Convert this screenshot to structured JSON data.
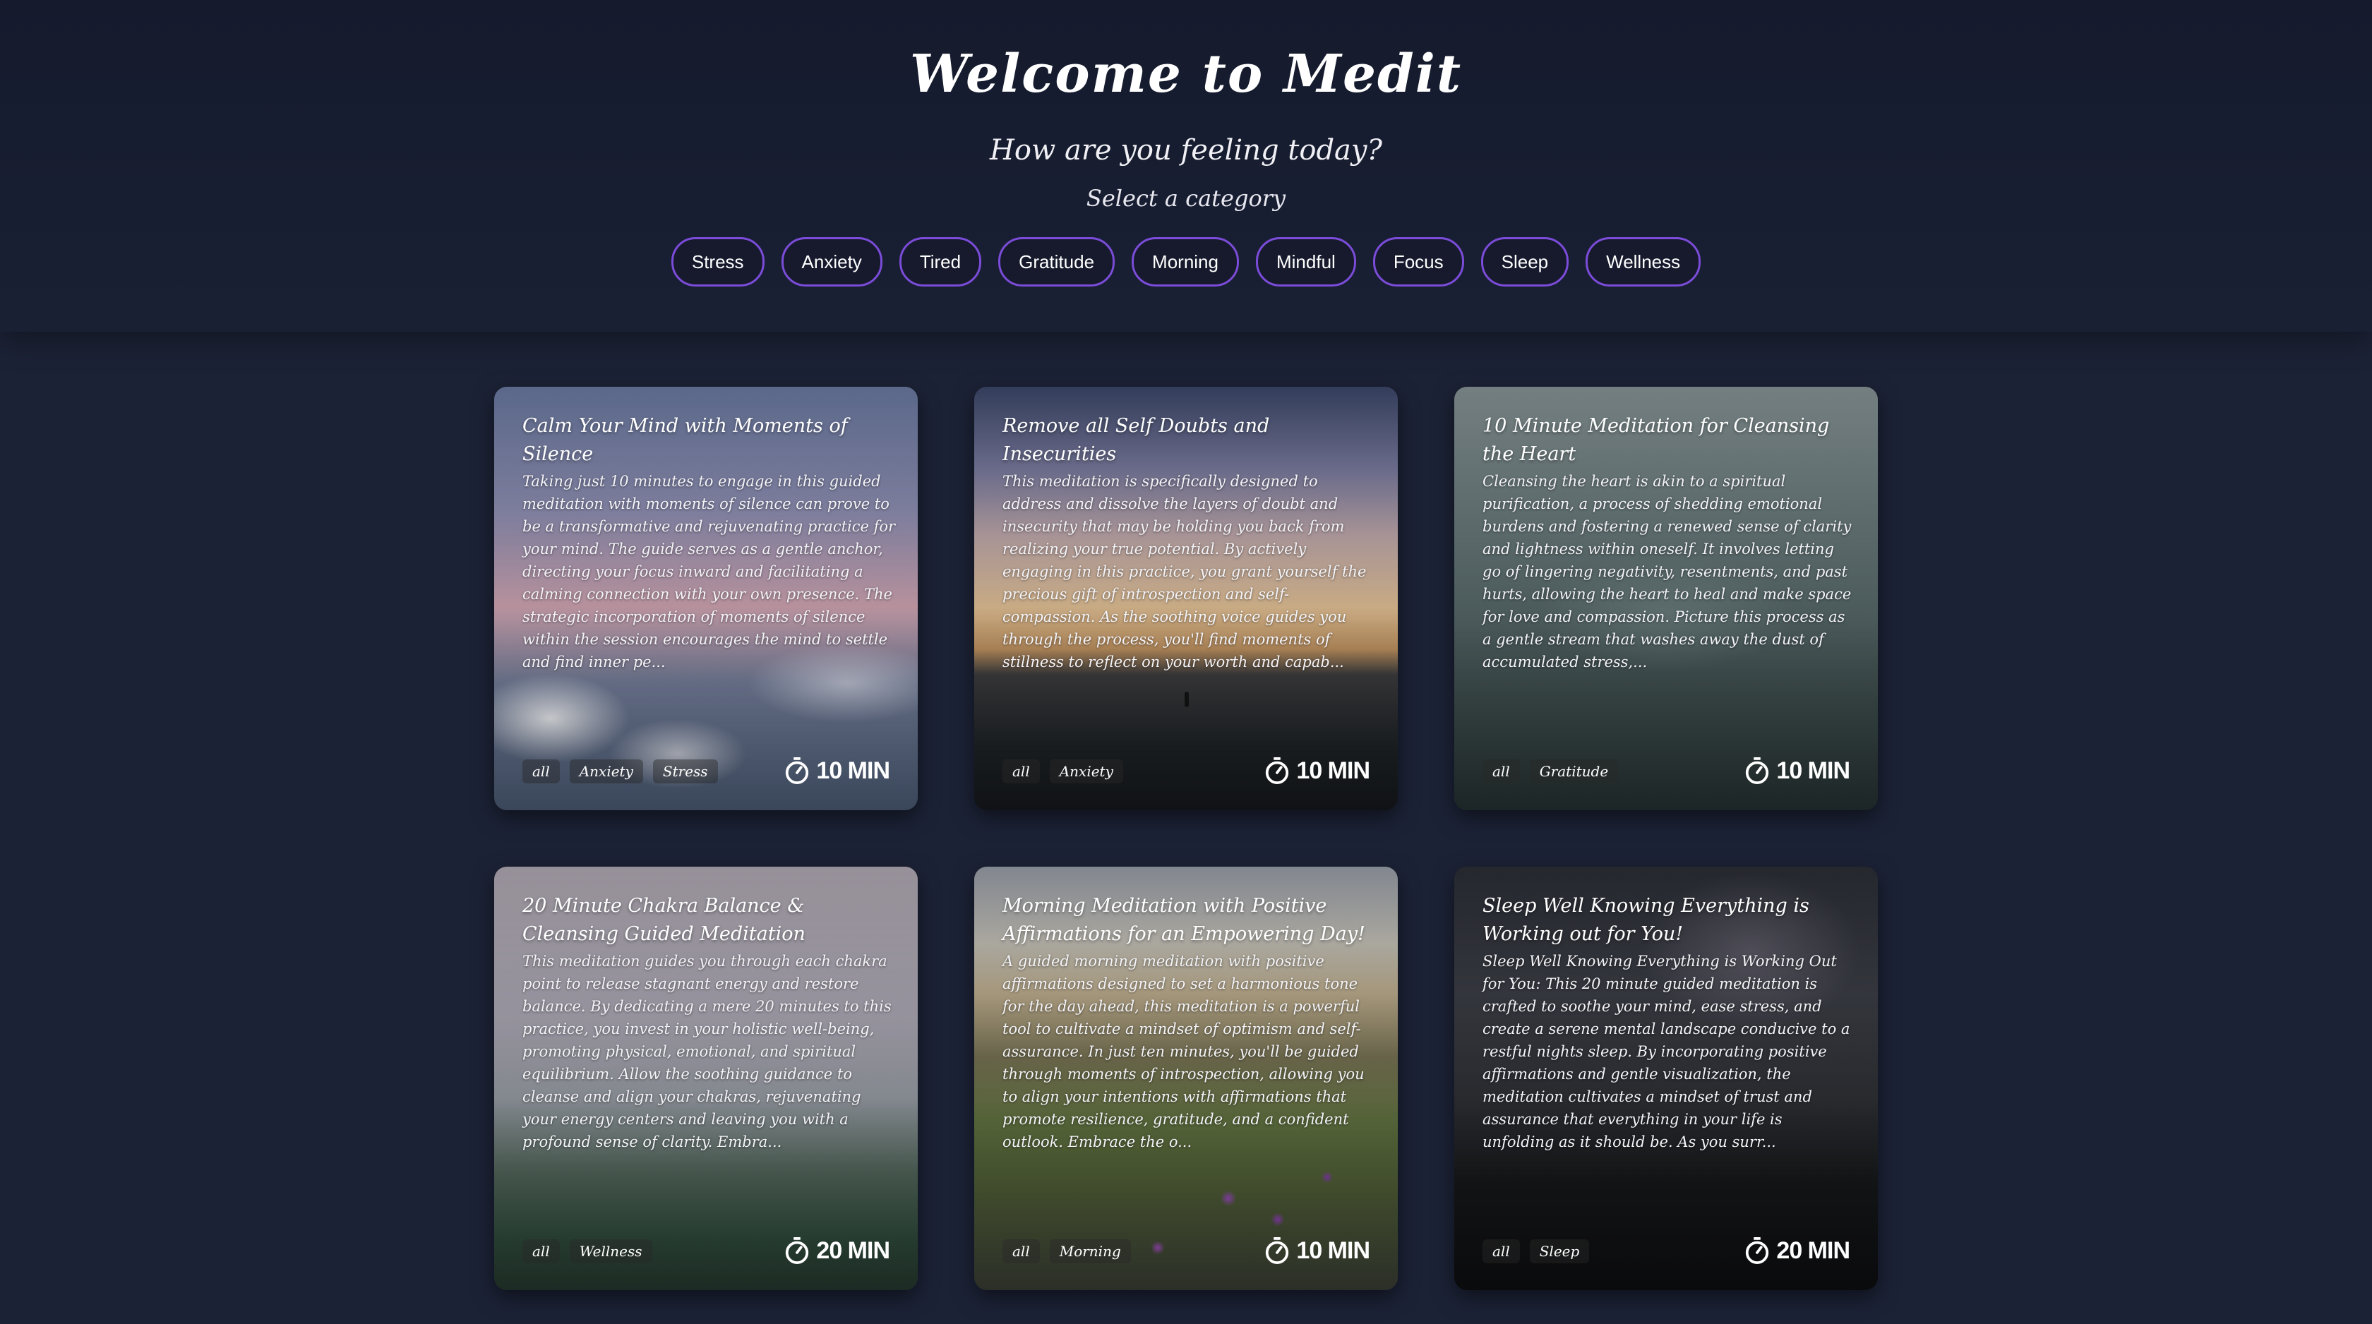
{
  "header": {
    "title": "Welcome to Medit",
    "subtitle": "How are you feeling today?",
    "prompt": "Select a category",
    "categories": [
      "Stress",
      "Anxiety",
      "Tired",
      "Gratitude",
      "Morning",
      "Mindful",
      "Focus",
      "Sleep",
      "Wellness"
    ]
  },
  "colors": {
    "accent": "#7b4cd9",
    "background": "#1c2236"
  },
  "cards": [
    {
      "title": "Calm Your Mind with Moments of Silence",
      "description": "Taking just 10 minutes to engage in this guided meditation with moments of silence can prove to be a transformative and rejuvenating practice for your mind. The guide serves as a gentle anchor, directing your focus inward and facilitating a calming connection with your own presence. The strategic incorporation of moments of silence within the session encourages the mind to settle and find inner pe...",
      "tags": [
        "all",
        "Anxiety",
        "Stress"
      ],
      "duration": "10 MIN",
      "icon": "timer-icon"
    },
    {
      "title": "Remove all Self Doubts and Insecurities",
      "description": "This meditation is specifically designed to address and dissolve the layers of doubt and insecurity that may be holding you back from realizing your true potential. By actively engaging in this practice, you grant yourself the precious gift of introspection and self-compassion. As the soothing voice guides you through the process, you'll find moments of stillness to reflect on your worth and capab...",
      "tags": [
        "all",
        "Anxiety"
      ],
      "duration": "10 MIN",
      "icon": "timer-icon"
    },
    {
      "title": "10 Minute Meditation for Cleansing the Heart",
      "description": "Cleansing the heart is akin to a spiritual purification, a process of shedding emotional burdens and fostering a renewed sense of clarity and lightness within oneself. It involves letting go of lingering negativity, resentments, and past hurts, allowing the heart to heal and make space for love and compassion. Picture this process as a gentle stream that washes away the dust of accumulated stress,...",
      "tags": [
        "all",
        "Gratitude"
      ],
      "duration": "10 MIN",
      "icon": "timer-icon"
    },
    {
      "title": "20 Minute Chakra Balance & Cleansing Guided Meditation",
      "description": "This meditation guides you through each chakra point to release stagnant energy and restore balance. By dedicating a mere 20 minutes to this practice, you invest in your holistic well-being, promoting physical, emotional, and spiritual equilibrium. Allow the soothing guidance to cleanse and align your chakras, rejuvenating your energy centers and leaving you with a profound sense of clarity. Embra...",
      "tags": [
        "all",
        "Wellness"
      ],
      "duration": "20 MIN",
      "icon": "timer-icon"
    },
    {
      "title": "Morning Meditation with Positive Affirmations for an Empowering Day!",
      "description": "A guided morning meditation with positive affirmations designed to set a harmonious tone for the day ahead, this meditation is a powerful tool to cultivate a mindset of optimism and self-assurance. In just ten minutes, you'll be guided through moments of introspection, allowing you to align your intentions with affirmations that promote resilience, gratitude, and a confident outlook. Embrace the o...",
      "tags": [
        "all",
        "Morning"
      ],
      "duration": "10 MIN",
      "icon": "timer-icon"
    },
    {
      "title": "Sleep Well Knowing Everything is Working out for You!",
      "description": "Sleep Well Knowing Everything is Working Out for You: This 20 minute guided meditation is crafted to soothe your mind, ease stress, and create a serene mental landscape conducive to a restful nights sleep. By incorporating positive affirmations and gentle visualization, the meditation cultivates a mindset of trust and assurance that everything in your life is unfolding as it should be. As you surr...",
      "tags": [
        "all",
        "Sleep"
      ],
      "duration": "20 MIN",
      "icon": "timer-icon"
    }
  ]
}
